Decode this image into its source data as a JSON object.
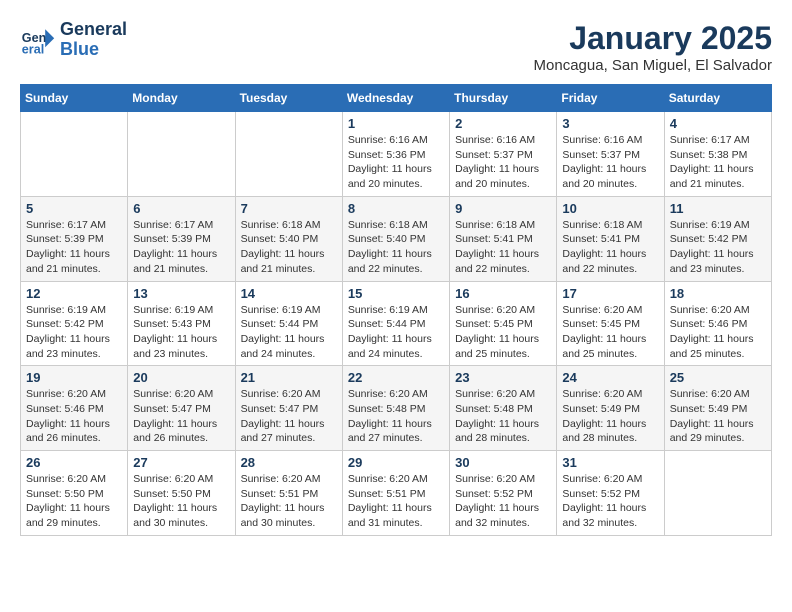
{
  "logo": {
    "line1": "General",
    "line2": "Blue"
  },
  "title": "January 2025",
  "subtitle": "Moncagua, San Miguel, El Salvador",
  "headers": [
    "Sunday",
    "Monday",
    "Tuesday",
    "Wednesday",
    "Thursday",
    "Friday",
    "Saturday"
  ],
  "weeks": [
    [
      {
        "day": "",
        "info": ""
      },
      {
        "day": "",
        "info": ""
      },
      {
        "day": "",
        "info": ""
      },
      {
        "day": "1",
        "info": "Sunrise: 6:16 AM\nSunset: 5:36 PM\nDaylight: 11 hours\nand 20 minutes."
      },
      {
        "day": "2",
        "info": "Sunrise: 6:16 AM\nSunset: 5:37 PM\nDaylight: 11 hours\nand 20 minutes."
      },
      {
        "day": "3",
        "info": "Sunrise: 6:16 AM\nSunset: 5:37 PM\nDaylight: 11 hours\nand 20 minutes."
      },
      {
        "day": "4",
        "info": "Sunrise: 6:17 AM\nSunset: 5:38 PM\nDaylight: 11 hours\nand 21 minutes."
      }
    ],
    [
      {
        "day": "5",
        "info": "Sunrise: 6:17 AM\nSunset: 5:39 PM\nDaylight: 11 hours\nand 21 minutes."
      },
      {
        "day": "6",
        "info": "Sunrise: 6:17 AM\nSunset: 5:39 PM\nDaylight: 11 hours\nand 21 minutes."
      },
      {
        "day": "7",
        "info": "Sunrise: 6:18 AM\nSunset: 5:40 PM\nDaylight: 11 hours\nand 21 minutes."
      },
      {
        "day": "8",
        "info": "Sunrise: 6:18 AM\nSunset: 5:40 PM\nDaylight: 11 hours\nand 22 minutes."
      },
      {
        "day": "9",
        "info": "Sunrise: 6:18 AM\nSunset: 5:41 PM\nDaylight: 11 hours\nand 22 minutes."
      },
      {
        "day": "10",
        "info": "Sunrise: 6:18 AM\nSunset: 5:41 PM\nDaylight: 11 hours\nand 22 minutes."
      },
      {
        "day": "11",
        "info": "Sunrise: 6:19 AM\nSunset: 5:42 PM\nDaylight: 11 hours\nand 23 minutes."
      }
    ],
    [
      {
        "day": "12",
        "info": "Sunrise: 6:19 AM\nSunset: 5:42 PM\nDaylight: 11 hours\nand 23 minutes."
      },
      {
        "day": "13",
        "info": "Sunrise: 6:19 AM\nSunset: 5:43 PM\nDaylight: 11 hours\nand 23 minutes."
      },
      {
        "day": "14",
        "info": "Sunrise: 6:19 AM\nSunset: 5:44 PM\nDaylight: 11 hours\nand 24 minutes."
      },
      {
        "day": "15",
        "info": "Sunrise: 6:19 AM\nSunset: 5:44 PM\nDaylight: 11 hours\nand 24 minutes."
      },
      {
        "day": "16",
        "info": "Sunrise: 6:20 AM\nSunset: 5:45 PM\nDaylight: 11 hours\nand 25 minutes."
      },
      {
        "day": "17",
        "info": "Sunrise: 6:20 AM\nSunset: 5:45 PM\nDaylight: 11 hours\nand 25 minutes."
      },
      {
        "day": "18",
        "info": "Sunrise: 6:20 AM\nSunset: 5:46 PM\nDaylight: 11 hours\nand 25 minutes."
      }
    ],
    [
      {
        "day": "19",
        "info": "Sunrise: 6:20 AM\nSunset: 5:46 PM\nDaylight: 11 hours\nand 26 minutes."
      },
      {
        "day": "20",
        "info": "Sunrise: 6:20 AM\nSunset: 5:47 PM\nDaylight: 11 hours\nand 26 minutes."
      },
      {
        "day": "21",
        "info": "Sunrise: 6:20 AM\nSunset: 5:47 PM\nDaylight: 11 hours\nand 27 minutes."
      },
      {
        "day": "22",
        "info": "Sunrise: 6:20 AM\nSunset: 5:48 PM\nDaylight: 11 hours\nand 27 minutes."
      },
      {
        "day": "23",
        "info": "Sunrise: 6:20 AM\nSunset: 5:48 PM\nDaylight: 11 hours\nand 28 minutes."
      },
      {
        "day": "24",
        "info": "Sunrise: 6:20 AM\nSunset: 5:49 PM\nDaylight: 11 hours\nand 28 minutes."
      },
      {
        "day": "25",
        "info": "Sunrise: 6:20 AM\nSunset: 5:49 PM\nDaylight: 11 hours\nand 29 minutes."
      }
    ],
    [
      {
        "day": "26",
        "info": "Sunrise: 6:20 AM\nSunset: 5:50 PM\nDaylight: 11 hours\nand 29 minutes."
      },
      {
        "day": "27",
        "info": "Sunrise: 6:20 AM\nSunset: 5:50 PM\nDaylight: 11 hours\nand 30 minutes."
      },
      {
        "day": "28",
        "info": "Sunrise: 6:20 AM\nSunset: 5:51 PM\nDaylight: 11 hours\nand 30 minutes."
      },
      {
        "day": "29",
        "info": "Sunrise: 6:20 AM\nSunset: 5:51 PM\nDaylight: 11 hours\nand 31 minutes."
      },
      {
        "day": "30",
        "info": "Sunrise: 6:20 AM\nSunset: 5:52 PM\nDaylight: 11 hours\nand 32 minutes."
      },
      {
        "day": "31",
        "info": "Sunrise: 6:20 AM\nSunset: 5:52 PM\nDaylight: 11 hours\nand 32 minutes."
      },
      {
        "day": "",
        "info": ""
      }
    ]
  ]
}
